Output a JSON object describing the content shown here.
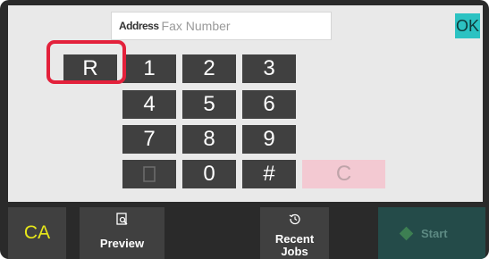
{
  "address_bar": {
    "address_label": "Address",
    "input_value": "",
    "input_placeholder": "Fax Number",
    "ok_label": "OK"
  },
  "keypad": {
    "keys": [
      "R",
      "1",
      "2",
      "3",
      "4",
      "5",
      "6",
      "7",
      "8",
      "9",
      "",
      "0",
      "#",
      "C"
    ],
    "highlighted_key": "R"
  },
  "bottom_bar": {
    "ca_label": "CA",
    "preview_label": "Preview",
    "preview_icon": "preview-icon",
    "recent_jobs_label": "Recent\nJobs",
    "recent_jobs_icon": "history-icon",
    "start_label": "Start",
    "start_icon": "start-icon"
  },
  "colors": {
    "ok": "#2cc2c2",
    "highlight_outline": "#e3213b",
    "key": "#404040",
    "clear_key": "#f3c9d2",
    "ca_text": "#e7e71a",
    "start_tile": "#244b49"
  }
}
